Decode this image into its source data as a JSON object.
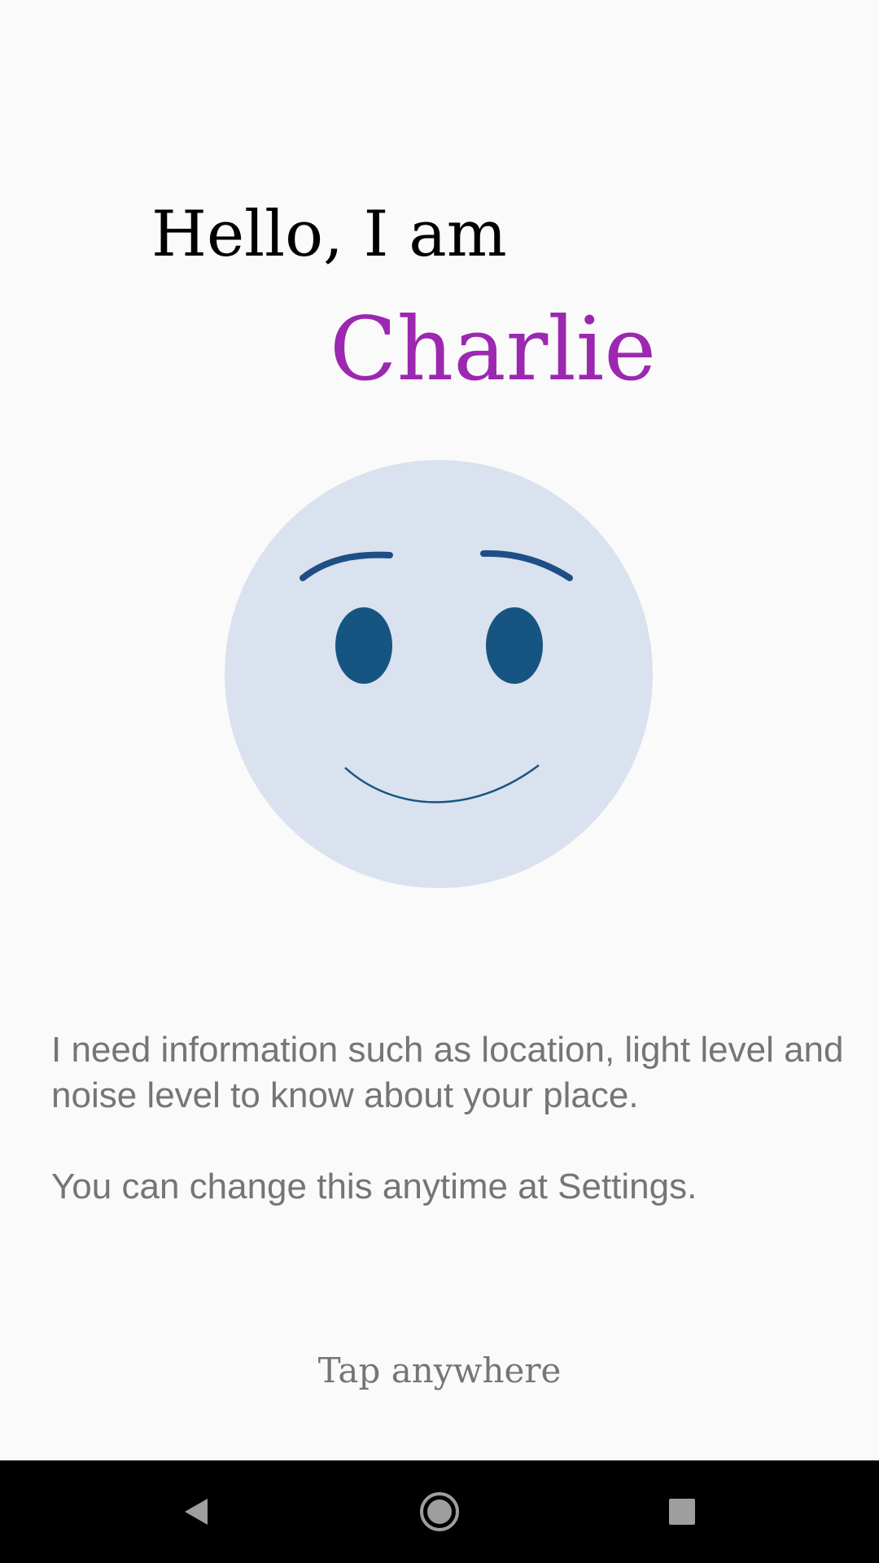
{
  "app": {
    "greeting": "Hello, I am",
    "name": "Charlie",
    "name_color": "#9C27B0"
  },
  "face": {
    "face_color": "#D9E2EE",
    "feature_color": "#165581",
    "brow_color": "#1F4E86",
    "expression": "smile"
  },
  "info": {
    "line1": "I need information such as location, light level and noise level to know about your place.",
    "line2": "You can change this anytime at Settings."
  },
  "tap_hint": "Tap anywhere",
  "navbar": {
    "back_icon": "back-triangle-icon",
    "home_icon": "home-circle-icon",
    "recents_icon": "recents-square-icon"
  }
}
